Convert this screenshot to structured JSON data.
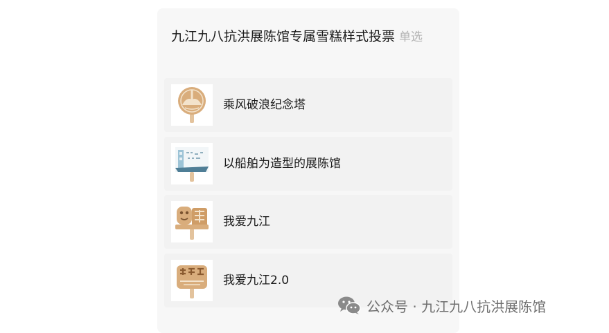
{
  "vote": {
    "title": "九江九八抗洪展陈馆专属雪糕样式投票",
    "type_tag": "单选",
    "options": [
      {
        "label": "乘风破浪纪念塔",
        "icon": "tower-popsicle-thumbnail"
      },
      {
        "label": "以船舶为造型的展陈馆",
        "icon": "ship-museum-popsicle-thumbnail"
      },
      {
        "label": "我爱九江",
        "icon": "i-love-jiujiang-popsicle-thumbnail"
      },
      {
        "label": "我爱九江2.0",
        "icon": "i-love-jiujiang-2-popsicle-thumbnail"
      }
    ]
  },
  "watermark": {
    "text": "公众号 · 九江九八抗洪展陈馆",
    "icon": "wechat-icon"
  },
  "colors": {
    "card_bg": "#f7f7f7",
    "option_bg": "#f2f2f2",
    "popsicle": "#d9ad7c",
    "tag": "#b2b2b2"
  }
}
